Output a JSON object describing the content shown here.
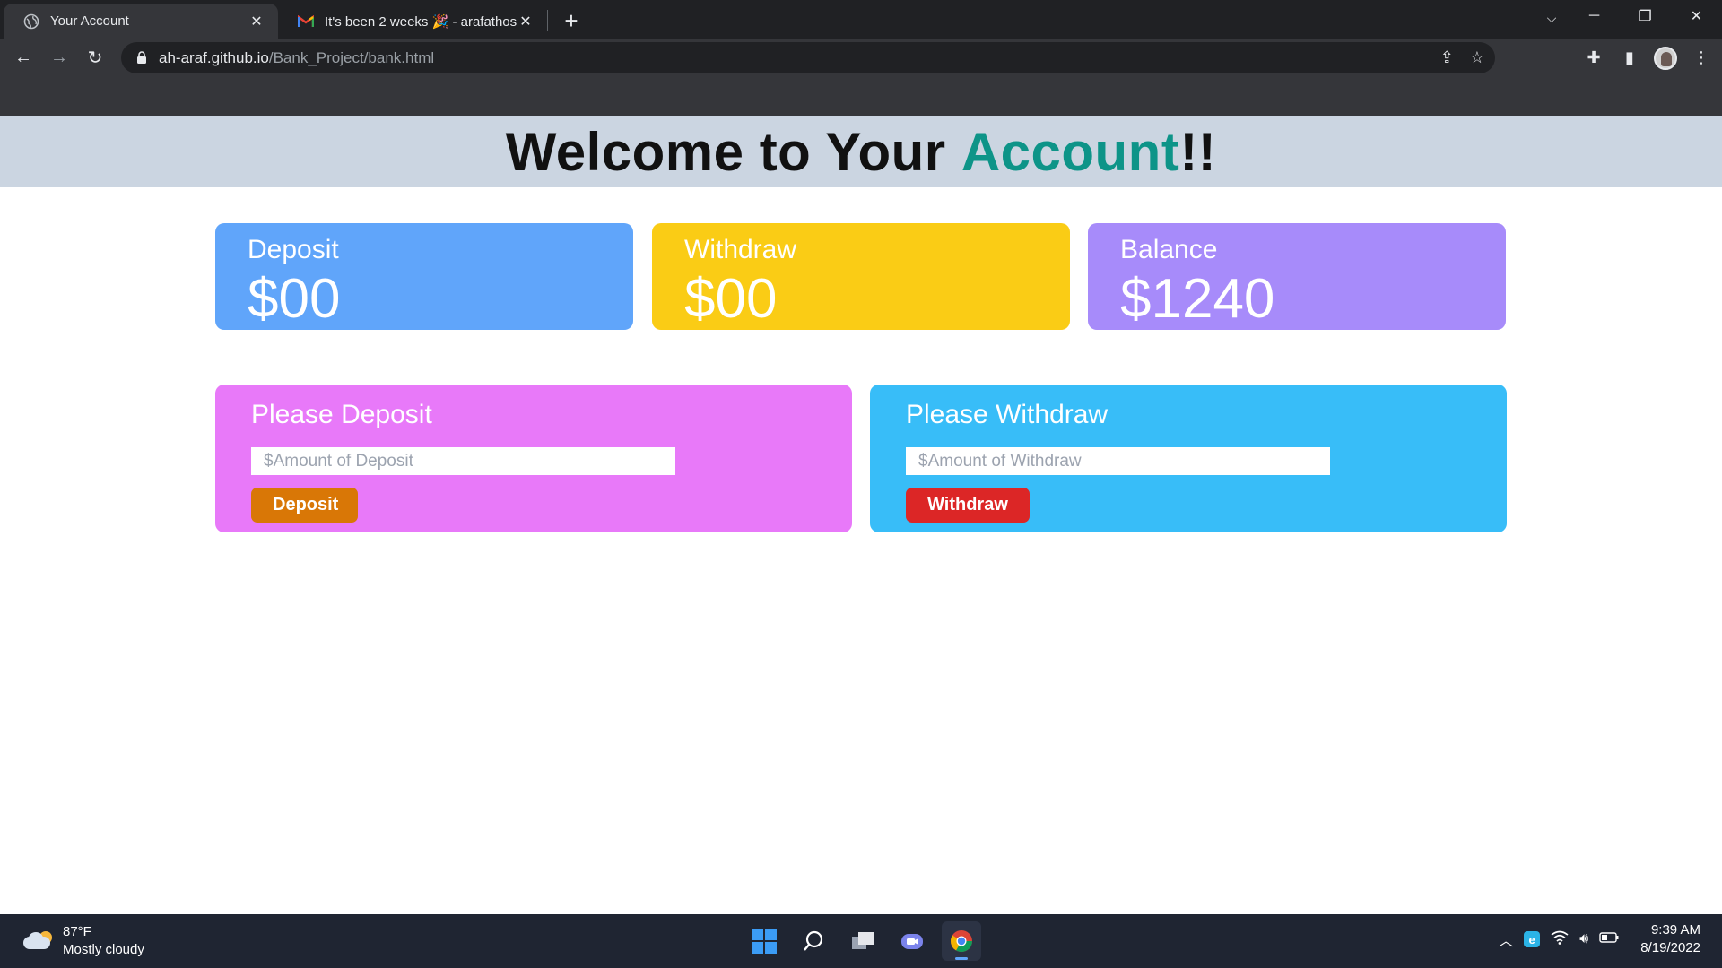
{
  "browser": {
    "tabs": [
      {
        "title": "Your Account",
        "active": true,
        "favicon": "globe-icon"
      },
      {
        "title": "It's been 2 weeks 🎉 - arafathoss",
        "active": false,
        "favicon": "gmail-icon"
      }
    ],
    "url_host": "ah-araf.github.io",
    "url_path": "/Bank_Project/bank.html"
  },
  "page": {
    "welcome_prefix": "Welcome to Your ",
    "welcome_accent": "Account",
    "welcome_suffix": "!!",
    "accent_color": "#0d9488"
  },
  "stats": {
    "deposit": {
      "label": "Deposit",
      "amount": "$00",
      "color": "#60a5fa"
    },
    "withdraw": {
      "label": "Withdraw",
      "amount": "$00",
      "color": "#facc15"
    },
    "balance": {
      "label": "Balance",
      "amount": "$1240",
      "color": "#a78bfa"
    }
  },
  "forms": {
    "deposit": {
      "title": "Please Deposit",
      "placeholder": "$Amount of Deposit",
      "button": "Deposit",
      "color": "#e879f9",
      "button_color": "#d97706"
    },
    "withdraw": {
      "title": "Please Withdraw",
      "placeholder": "$Amount of Withdraw",
      "button": "Withdraw",
      "color": "#38bdf8",
      "button_color": "#dc2626"
    }
  },
  "taskbar": {
    "weather_temp": "87°F",
    "weather_desc": "Mostly cloudy",
    "time": "9:39 AM",
    "date": "8/19/2022"
  }
}
